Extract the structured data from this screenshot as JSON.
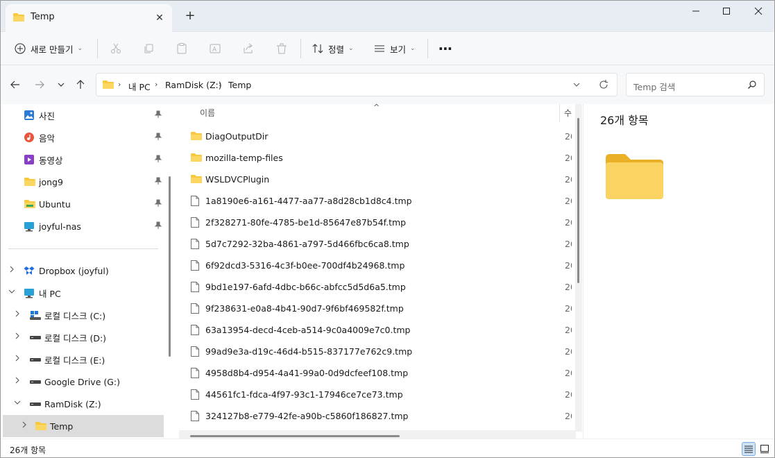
{
  "window": {
    "tab_title": "Temp",
    "close_tab_glyph": "✕",
    "new_tab_glyph": "+"
  },
  "toolbar": {
    "new_label": "새로 만들기",
    "sort_label": "정렬",
    "view_label": "보기",
    "more_glyph": "⋯",
    "caret": "⌄"
  },
  "address": {
    "crumbs": [
      "내 PC",
      "RamDisk (Z:)",
      "Temp"
    ],
    "separator": "›",
    "search_placeholder": "Temp 검색"
  },
  "sidebar": {
    "pinned": [
      {
        "label": "사진",
        "icon": "photos-icon"
      },
      {
        "label": "음악",
        "icon": "music-icon"
      },
      {
        "label": "동영상",
        "icon": "videos-icon"
      },
      {
        "label": "jong9",
        "icon": "folder-icon"
      },
      {
        "label": "Ubuntu",
        "icon": "folder-icon"
      },
      {
        "label": "joyful-nas",
        "icon": "network-drive-icon"
      }
    ],
    "tree": [
      {
        "label": "Dropbox (joyful)",
        "icon": "dropbox-icon",
        "expanded": false
      },
      {
        "label": "내 PC",
        "icon": "pc-icon",
        "expanded": true
      },
      {
        "label": "로컬 디스크 (C:)",
        "icon": "windows-drive-icon",
        "expanded": false
      },
      {
        "label": "로컬 디스크 (D:)",
        "icon": "drive-icon",
        "expanded": false
      },
      {
        "label": "로컬 디스크 (E:)",
        "icon": "drive-icon",
        "expanded": false
      },
      {
        "label": "Google Drive (G:)",
        "icon": "drive-icon",
        "expanded": false
      },
      {
        "label": "RamDisk (Z:)",
        "icon": "drive-icon",
        "expanded": true
      },
      {
        "label": "Temp",
        "icon": "folder-icon",
        "expanded": false,
        "selected": true
      }
    ]
  },
  "filelist": {
    "col_name": "이름",
    "col_date": "수",
    "sort_glyph": "^",
    "date_prefix": "20",
    "rows": [
      {
        "name": "DiagOutputDir",
        "type": "folder"
      },
      {
        "name": "mozilla-temp-files",
        "type": "folder"
      },
      {
        "name": "WSLDVCPlugin",
        "type": "folder"
      },
      {
        "name": "1a8190e6-a161-4477-aa77-a8d28cb1d8c4.tmp",
        "type": "file"
      },
      {
        "name": "2f328271-80fe-4785-be1d-85647e87b54f.tmp",
        "type": "file"
      },
      {
        "name": "5d7c7292-32ba-4861-a797-5d466fbc6ca8.tmp",
        "type": "file"
      },
      {
        "name": "6f92dcd3-5316-4c3f-b0ee-700df4b24968.tmp",
        "type": "file"
      },
      {
        "name": "9bd1e197-6afd-4dbc-b66c-abfcc5d5d6a5.tmp",
        "type": "file"
      },
      {
        "name": "9f238631-e0a8-4b41-90d7-9f6bf469582f.tmp",
        "type": "file"
      },
      {
        "name": "63a13954-decd-4ceb-a514-9c0a4009e7c0.tmp",
        "type": "file"
      },
      {
        "name": "99ad9e3a-d19c-46d4-b515-837177e762c9.tmp",
        "type": "file"
      },
      {
        "name": "4958d8b4-d954-4a41-99a0-0d9dcfeef108.tmp",
        "type": "file"
      },
      {
        "name": "44561fc1-fdca-4f97-93c1-17946ce7ce73.tmp",
        "type": "file"
      },
      {
        "name": "324127b8-e779-42fe-a90b-c5860f186827.tmp",
        "type": "file"
      }
    ]
  },
  "details": {
    "count_label": "26개 항목"
  },
  "status": {
    "count_label": "26개 항목"
  },
  "colors": {
    "folder_yellow": "#f8c93c",
    "accent_blue": "#1f6fc9",
    "selected_bg": "#dcdcdc"
  }
}
